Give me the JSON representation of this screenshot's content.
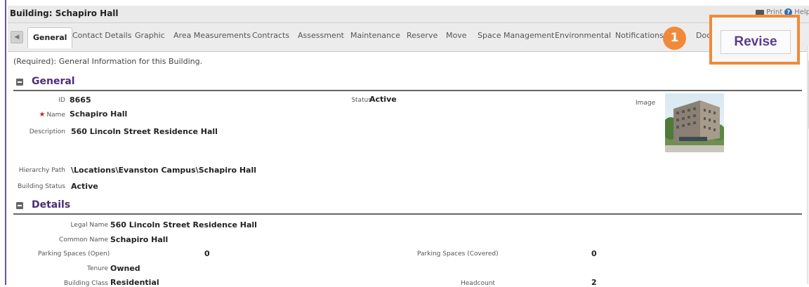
{
  "window": {
    "title": "Building: Schapiro Hall",
    "print_label": "Print",
    "help_label": "Help"
  },
  "tabs": [
    {
      "label": "General"
    },
    {
      "label": "Contact Details"
    },
    {
      "label": "Graphic"
    },
    {
      "label": "Area Measurements"
    },
    {
      "label": "Contracts"
    },
    {
      "label": "Assessment"
    },
    {
      "label": "Maintenance"
    },
    {
      "label": "Reserve"
    },
    {
      "label": "Move"
    },
    {
      "label": "Space Management"
    },
    {
      "label": "Environmental"
    },
    {
      "label": "Notifications"
    },
    {
      "label": "Doc"
    }
  ],
  "callout": {
    "number": "1",
    "revise_label": "Revise",
    "accent_color": "#f08a3a"
  },
  "required_note": "(Required): General Information for this Building.",
  "general": {
    "title": "General",
    "id_label": "ID",
    "id_value": "8665",
    "name_label": "Name",
    "name_value": "Schapiro Hall",
    "description_label": "Description",
    "description_value": "560 Lincoln Street Residence Hall",
    "status_label": "Status",
    "status_value": "Active",
    "image_label": "Image",
    "hierarchy_label": "Hierarchy Path",
    "hierarchy_value": "\\Locations\\Evanston Campus\\Schapiro Hall",
    "building_status_label": "Building Status",
    "building_status_value": "Active"
  },
  "details": {
    "title": "Details",
    "legal_name_label": "Legal Name",
    "legal_name_value": "560 Lincoln Street Residence Hall",
    "common_name_label": "Common Name",
    "common_name_value": "Schapiro Hall",
    "parking_open_label": "Parking Spaces (Open)",
    "parking_open_value": "0",
    "parking_covered_label": "Parking Spaces (Covered)",
    "parking_covered_value": "0",
    "tenure_label": "Tenure",
    "tenure_value": "Owned",
    "building_class_label": "Building Class",
    "building_class_value": "Residential",
    "headcount_label": "Headcount",
    "headcount_value": "2"
  }
}
